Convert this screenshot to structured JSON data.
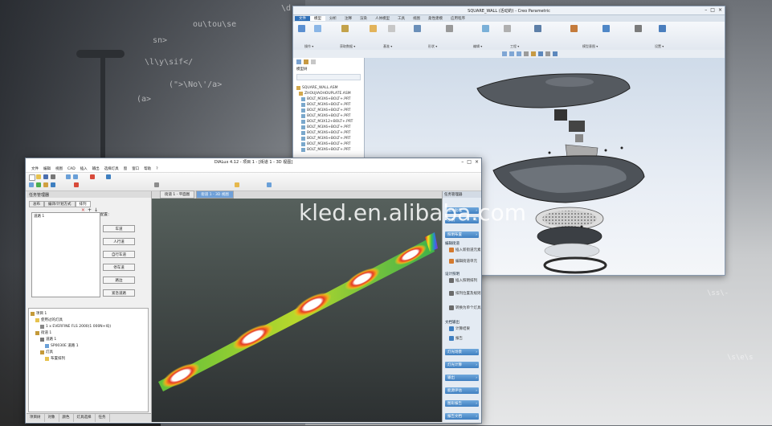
{
  "background": {
    "code_lines": [
      "\\d",
      "ou\\tou\\se",
      "sn>",
      "\\l\\y\\sif</",
      "(\">\\No\\'/a>",
      "(a>",
      "\\ss\\-",
      "\\s\\e\\s"
    ]
  },
  "watermark": "kled.en.alibaba.com",
  "creo": {
    "title": "SQUARE_WALL (活动的) - Creo Parametric",
    "tabs": [
      "文件",
      "模型",
      "分析",
      "注释",
      "渲染",
      "人体模型",
      "工具",
      "视图",
      "柔性建模",
      "应用程序"
    ],
    "ribbon_groups": [
      "操作 ▾",
      "获取数据 ▾",
      "基准 ▾",
      "形状 ▾",
      "编辑 ▾",
      "工程 ▾",
      "模型意图 ▾",
      "设置 ▾"
    ],
    "tree_header": "模型树",
    "tree_items": [
      "SQUARE_WALL.ASM",
      "ZHOUJIAOHOUPLATE.ASM",
      "BOLT_M3X6+BOLT+.PRT",
      "BOLT_M3X6+BOLT+.PRT",
      "BOLT_M3X6+BOLT+.PRT",
      "BOLT_M3X6+BOLT+.PRT",
      "BOLT_M3X12+BOLT+.PRT",
      "BOLT_M3X6+BOLT+.PRT",
      "BOLT_M3X6+BOLT+.PRT",
      "BOLT_M3X6+BOLT+.PRT",
      "BOLT_M3X6+BOLT+.PRT",
      "BOLT_M3X6+BOLT+.PRT"
    ]
  },
  "dialux": {
    "title": "DIALux 4.12 - 项目 1 - [街道 1 - 3D 视图]",
    "menu": [
      "文件",
      "编辑",
      "视图",
      "CAD",
      "插入",
      "输出",
      "选择灯具",
      "窗",
      "窗口",
      "帮助",
      "?"
    ],
    "panel_title": "任务管理器",
    "panel_tabs": [
      "总布",
      "编译/计划方式",
      "排列"
    ],
    "list_title": "配置：",
    "list_items": [
      "道路 1"
    ],
    "list_buttons": [
      "车道",
      "人行道",
      "自行车道",
      "停车道",
      "路边",
      "紧急道路"
    ],
    "project_tree": [
      "项目 1",
      "使用过的灯具",
      "1 x EVERFINE FLS 2000(1 000N+IQ)",
      "街道 1",
      "道路 1",
      "SP0030E 道路 1",
      "灯具",
      "布置排列"
    ],
    "bottom_tabs": [
      "项目树",
      "对象",
      "颜色",
      "灯具选择",
      "任务"
    ],
    "view_tabs": [
      "街道 1 - 平面图",
      "街道 1 - 3D 视图"
    ],
    "right_header": "任务管理器",
    "right_buttons_top": [
      "设计助理",
      "示例",
      "照明布置"
    ],
    "right_sections": [
      {
        "title": "编辑街道",
        "items": [
          "插入新街道元素",
          "编辑街道单元"
        ]
      },
      {
        "title": "设计照明",
        "items": [
          "插入照明排列",
          "排列位置及规则",
          "转换为单个灯具"
        ]
      },
      {
        "title": "文档输出",
        "items": [
          "计算结果",
          "报告"
        ]
      }
    ],
    "right_buttons_bottom": [
      "灯光场景",
      "灯光计算",
      "输出",
      "能源评估",
      "图形报告",
      "报告文档"
    ]
  },
  "colors": {
    "creo_accent": "#2e6fb8",
    "dialux_panel_blue": "#3f7fc0",
    "heatmap_bg": "#3a3e40"
  }
}
